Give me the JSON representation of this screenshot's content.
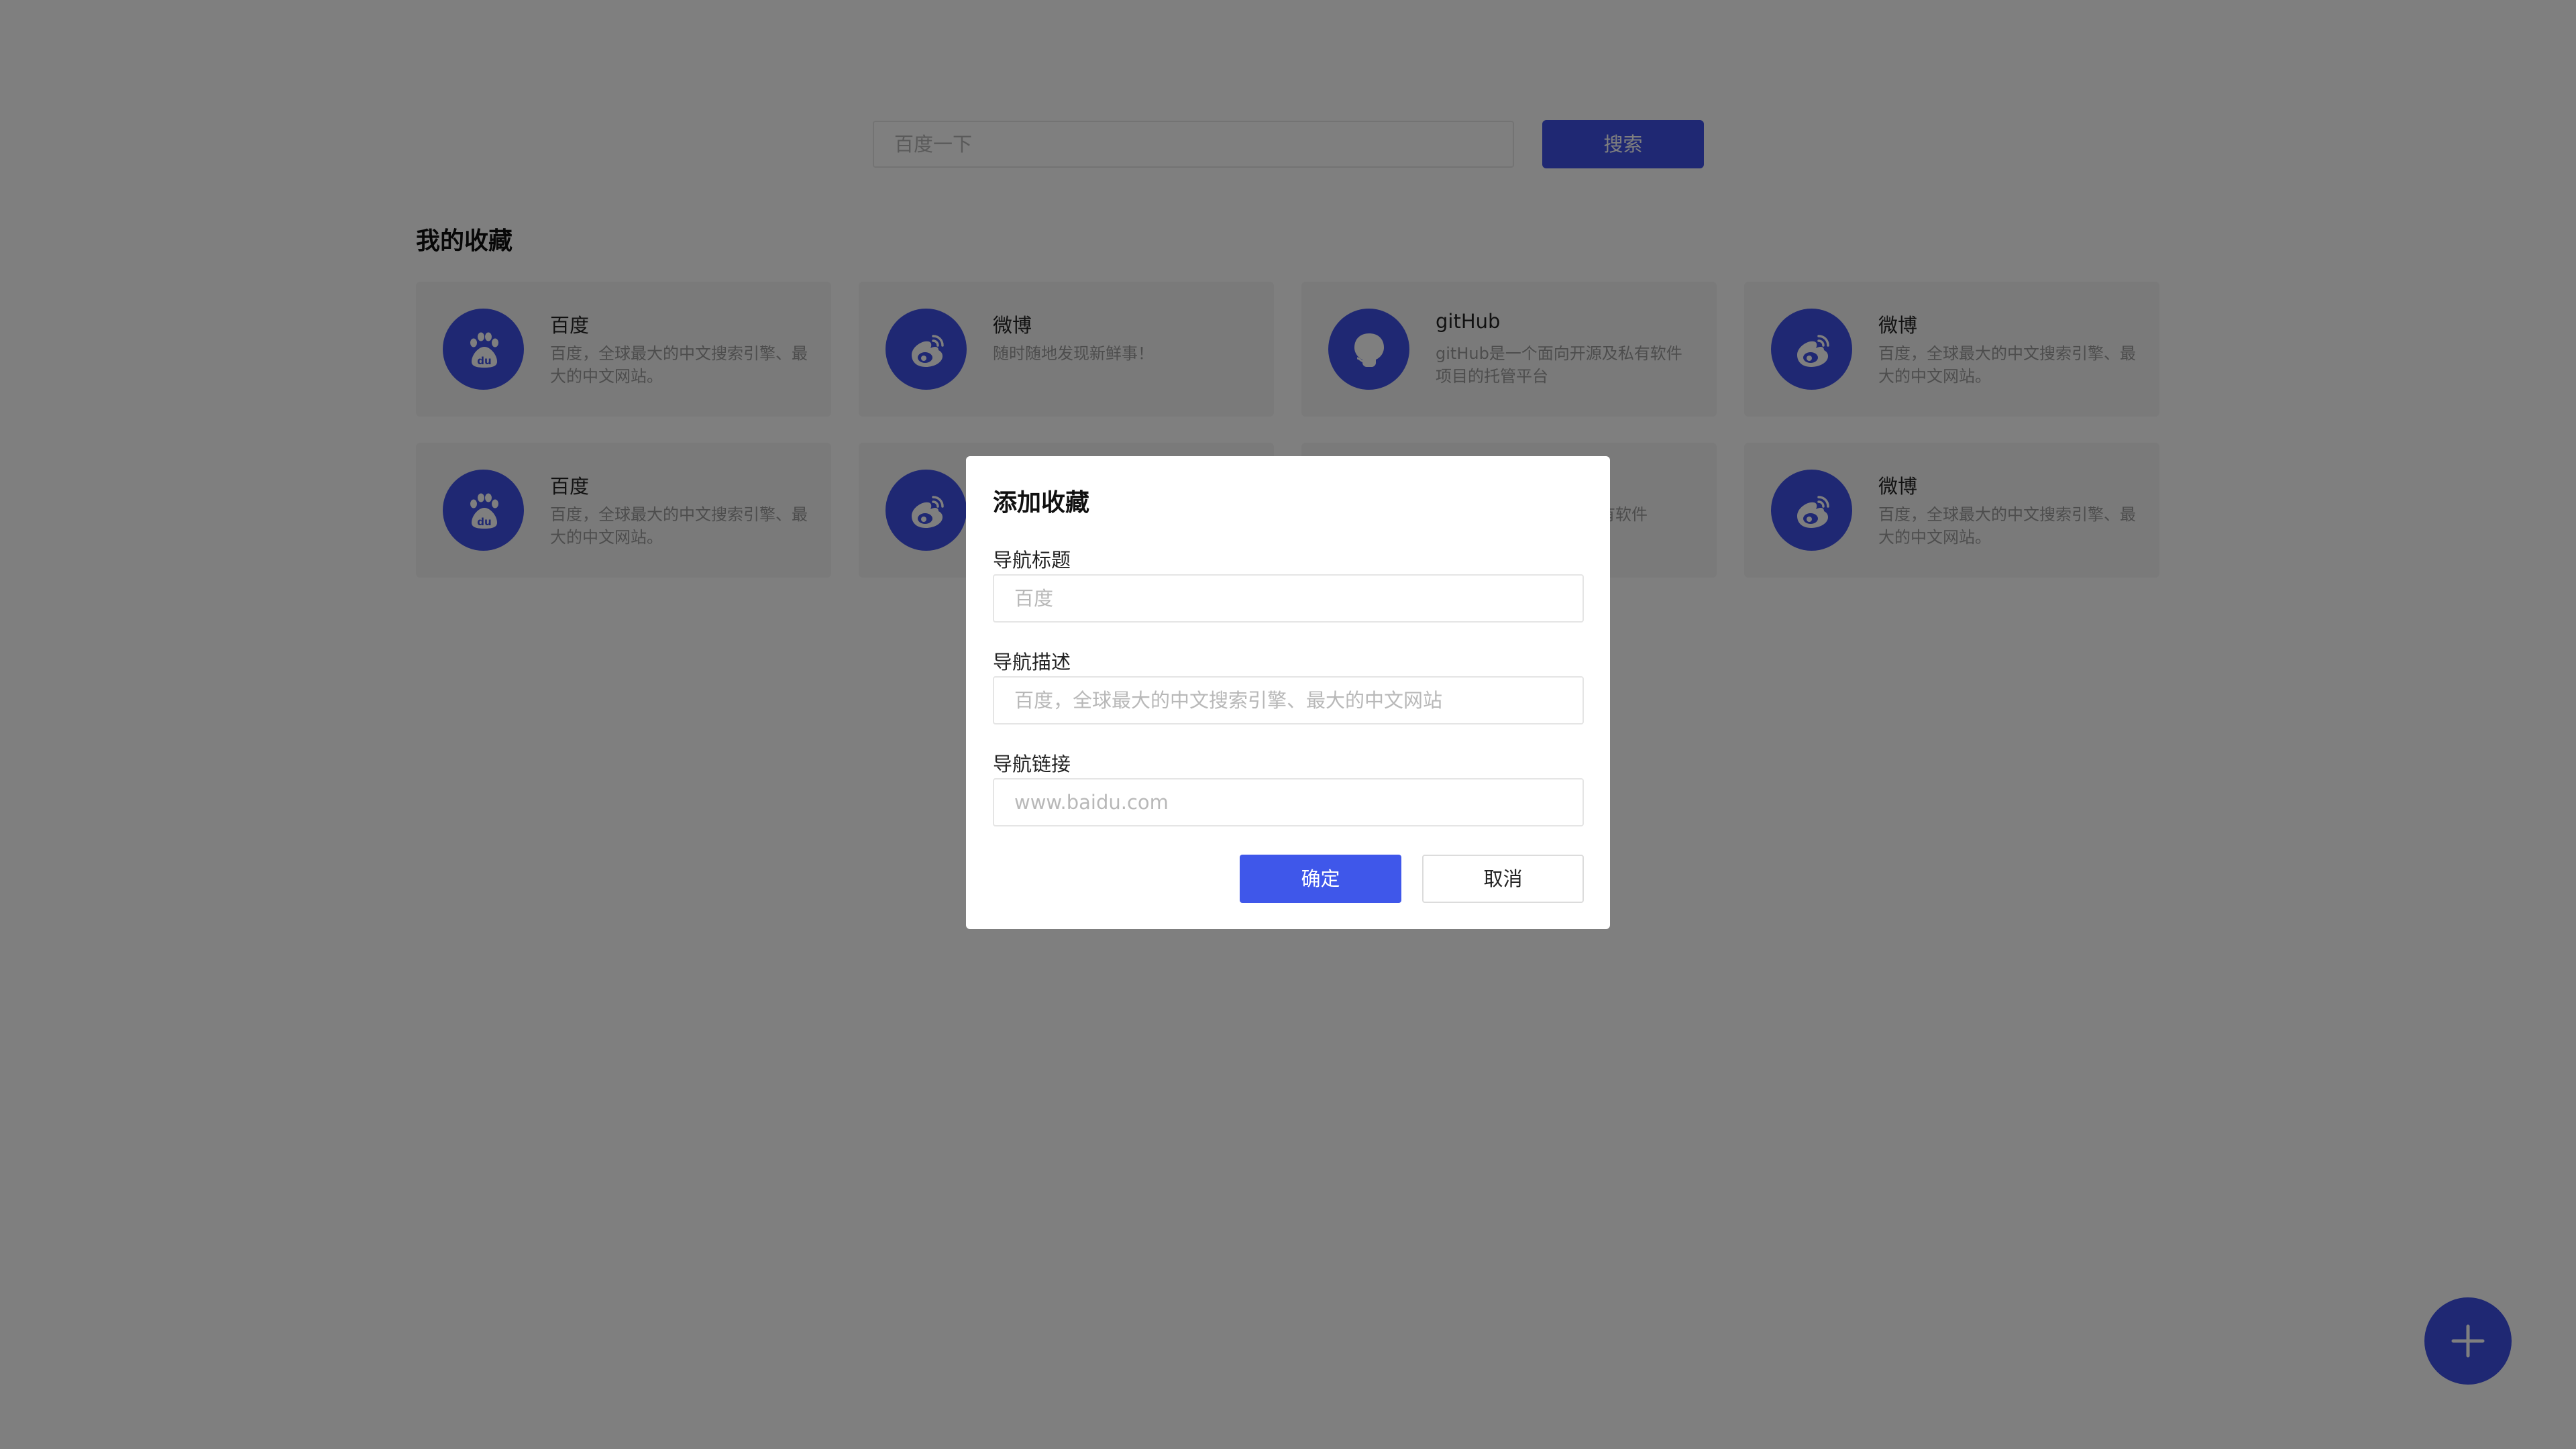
{
  "search": {
    "placeholder": "百度一下",
    "button_label": "搜索"
  },
  "favorites": {
    "title": "我的收藏",
    "cards": [
      {
        "title": "百度",
        "desc": "百度，全球最大的中文搜索引擎、最大的中文网站。",
        "icon": "baidu-icon"
      },
      {
        "title": "微博",
        "desc": "随时随地发现新鲜事！",
        "icon": "weibo-icon"
      },
      {
        "title": "gitHub",
        "desc": "gitHub是一个面向开源及私有软件项目的托管平台",
        "icon": "github-icon"
      },
      {
        "title": "微博",
        "desc": "百度，全球最大的中文搜索引擎、最大的中文网站。",
        "icon": "weibo-icon"
      },
      {
        "title": "百度",
        "desc": "百度，全球最大的中文搜索引擎、最大的中文网站。",
        "icon": "baidu-icon"
      },
      {
        "title": "",
        "desc": "",
        "icon": "weibo-icon"
      },
      {
        "title": "",
        "desc": "私有软件",
        "icon": "github-icon"
      },
      {
        "title": "微博",
        "desc": "百度，全球最大的中文搜索引擎、最大的中文网站。",
        "icon": "weibo-icon"
      }
    ]
  },
  "fab": {
    "icon": "plus-icon"
  },
  "dialog": {
    "title": "添加收藏",
    "fields": [
      {
        "label": "导航标题",
        "placeholder": "百度"
      },
      {
        "label": "导航描述",
        "placeholder": "百度，全球最大的中文搜索引擎、最大的中文网站"
      },
      {
        "label": "导航链接",
        "placeholder": "www.baidu.com"
      }
    ],
    "confirm_label": "确定",
    "cancel_label": "取消"
  },
  "colors": {
    "accent": "#3f51e6",
    "overlay": "rgba(0,0,0,0.5)",
    "card_bg": "#f5f5f5"
  }
}
